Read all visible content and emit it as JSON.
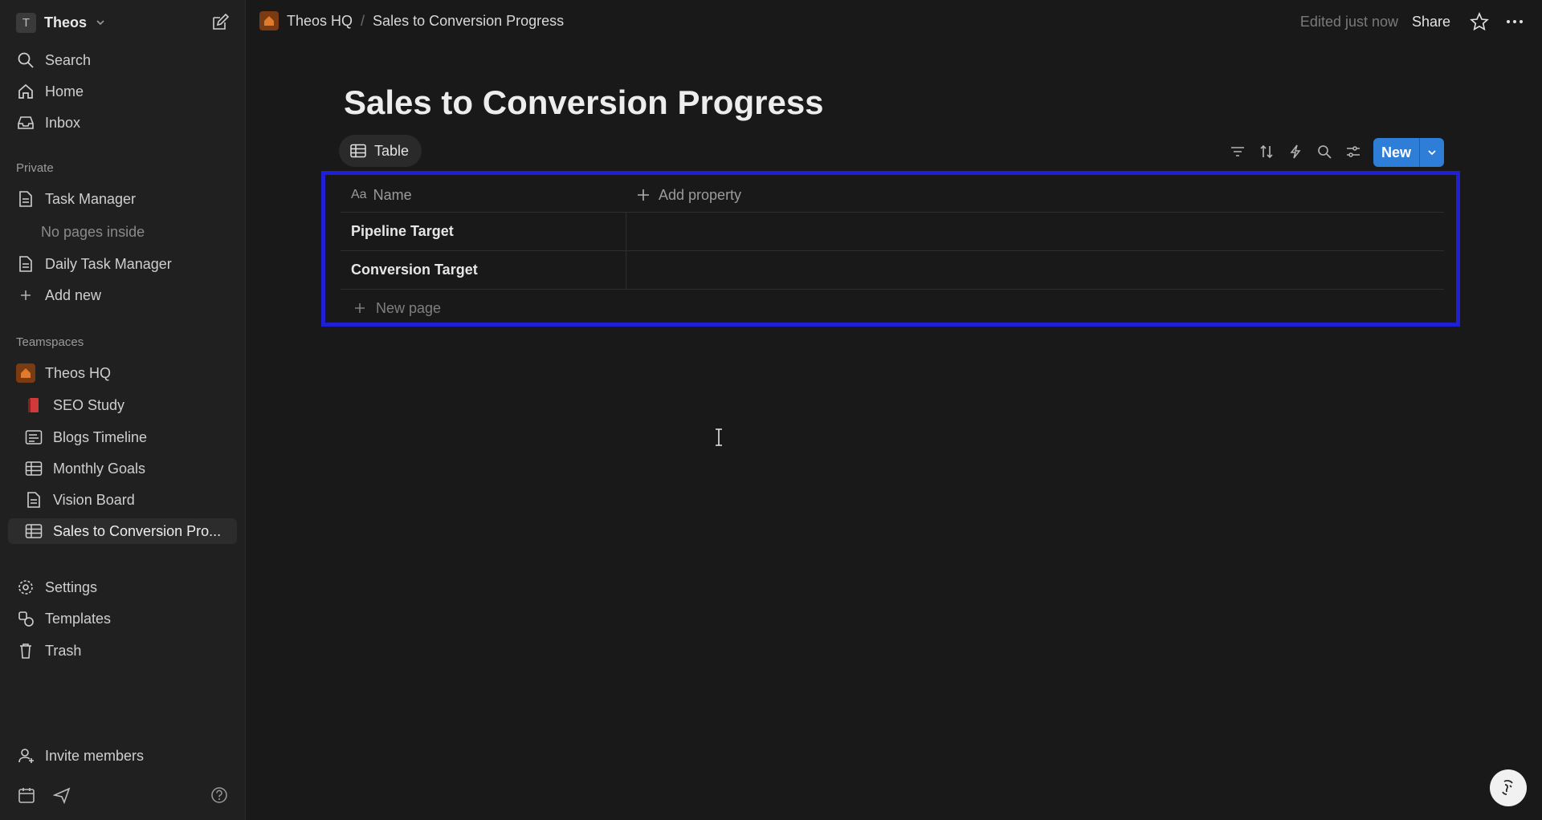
{
  "workspace": {
    "initial": "T",
    "name": "Theos"
  },
  "nav": {
    "search": "Search",
    "home": "Home",
    "inbox": "Inbox"
  },
  "private": {
    "label": "Private",
    "items": [
      {
        "label": "Task Manager"
      },
      {
        "label": "No pages inside"
      },
      {
        "label": "Daily Task Manager"
      },
      {
        "label": "Add new"
      }
    ]
  },
  "teamspaces": {
    "label": "Teamspaces",
    "team": "Theos HQ",
    "items": [
      {
        "label": "SEO Study",
        "icon": "red-book-icon"
      },
      {
        "label": "Blogs Timeline",
        "icon": "timeline-icon"
      },
      {
        "label": "Monthly Goals",
        "icon": "table-icon"
      },
      {
        "label": "Vision Board",
        "icon": "page-icon"
      },
      {
        "label": "Sales to Conversion Pro...",
        "icon": "table-icon"
      }
    ]
  },
  "footer_nav": {
    "settings": "Settings",
    "templates": "Templates",
    "trash": "Trash",
    "invite": "Invite members"
  },
  "topbar": {
    "breadcrumb": [
      "Theos HQ",
      "/",
      "Sales to Conversion Progress"
    ],
    "edited": "Edited just now",
    "share": "Share"
  },
  "page": {
    "title": "Sales to Conversion Progress",
    "view_tab": "Table",
    "new_button": "New"
  },
  "table": {
    "name_header": "Name",
    "name_header_icon": "Aa",
    "add_property": "Add property",
    "rows": [
      "Pipeline Target",
      "Conversion Target"
    ],
    "new_page": "New page"
  },
  "colors": {
    "background": "#191919",
    "sidebar": "#202020",
    "accent_button": "#2e7dd6",
    "highlight_box": "#1f1fd6"
  }
}
